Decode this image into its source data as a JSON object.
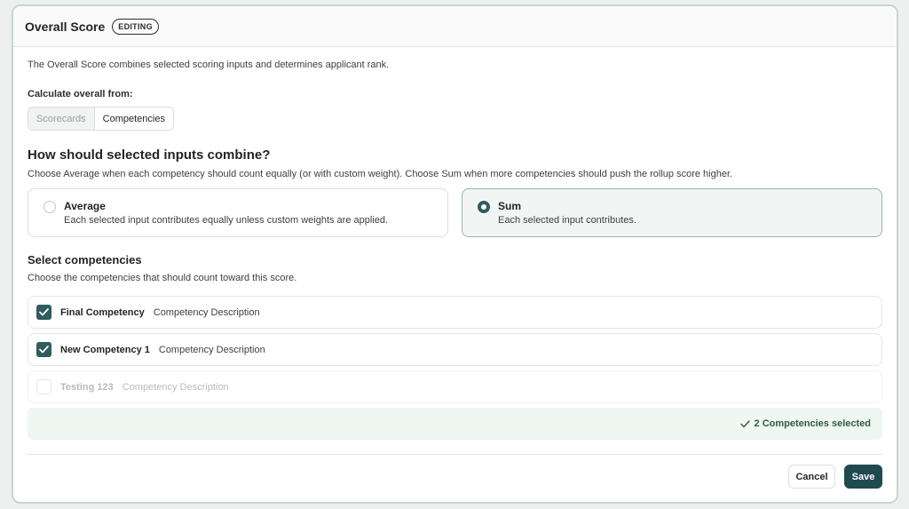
{
  "header": {
    "title": "Overall Score",
    "badge": "EDITING"
  },
  "intro": "The Overall Score combines selected scoring inputs and determines applicant rank.",
  "calculate": {
    "label": "Calculate overall from:",
    "options": [
      {
        "label": "Scorecards",
        "selected": false
      },
      {
        "label": "Competencies",
        "selected": true
      }
    ]
  },
  "combine": {
    "heading": "How should selected inputs combine?",
    "subheading": "Choose Average when each competency should count equally (or with custom weight). Choose Sum when more competencies should push the rollup score higher.",
    "options": [
      {
        "title": "Average",
        "desc": "Each selected input contributes equally unless custom weights are applied.",
        "selected": false
      },
      {
        "title": "Sum",
        "desc": "Each selected input contributes.",
        "selected": true
      }
    ]
  },
  "competencies": {
    "heading": "Select competencies",
    "subheading": "Choose the competencies that should count toward this score.",
    "items": [
      {
        "name": "Final Competency",
        "desc": "Competency Description",
        "checked": true
      },
      {
        "name": "New Competency 1",
        "desc": "Competency Description",
        "checked": true
      },
      {
        "name": "Testing 123",
        "desc": "Competency Description",
        "checked": false
      }
    ],
    "summary": "2 Competencies selected"
  },
  "footer": {
    "cancel": "Cancel",
    "save": "Save"
  },
  "colors": {
    "accent": "#2f5c5c",
    "save_bg": "#1f4a4f",
    "selected_bg": "#f1f6f5",
    "summary_bg": "#f0f6f1"
  },
  "icons": {
    "check": "check-icon",
    "radio": "radio-icon"
  }
}
